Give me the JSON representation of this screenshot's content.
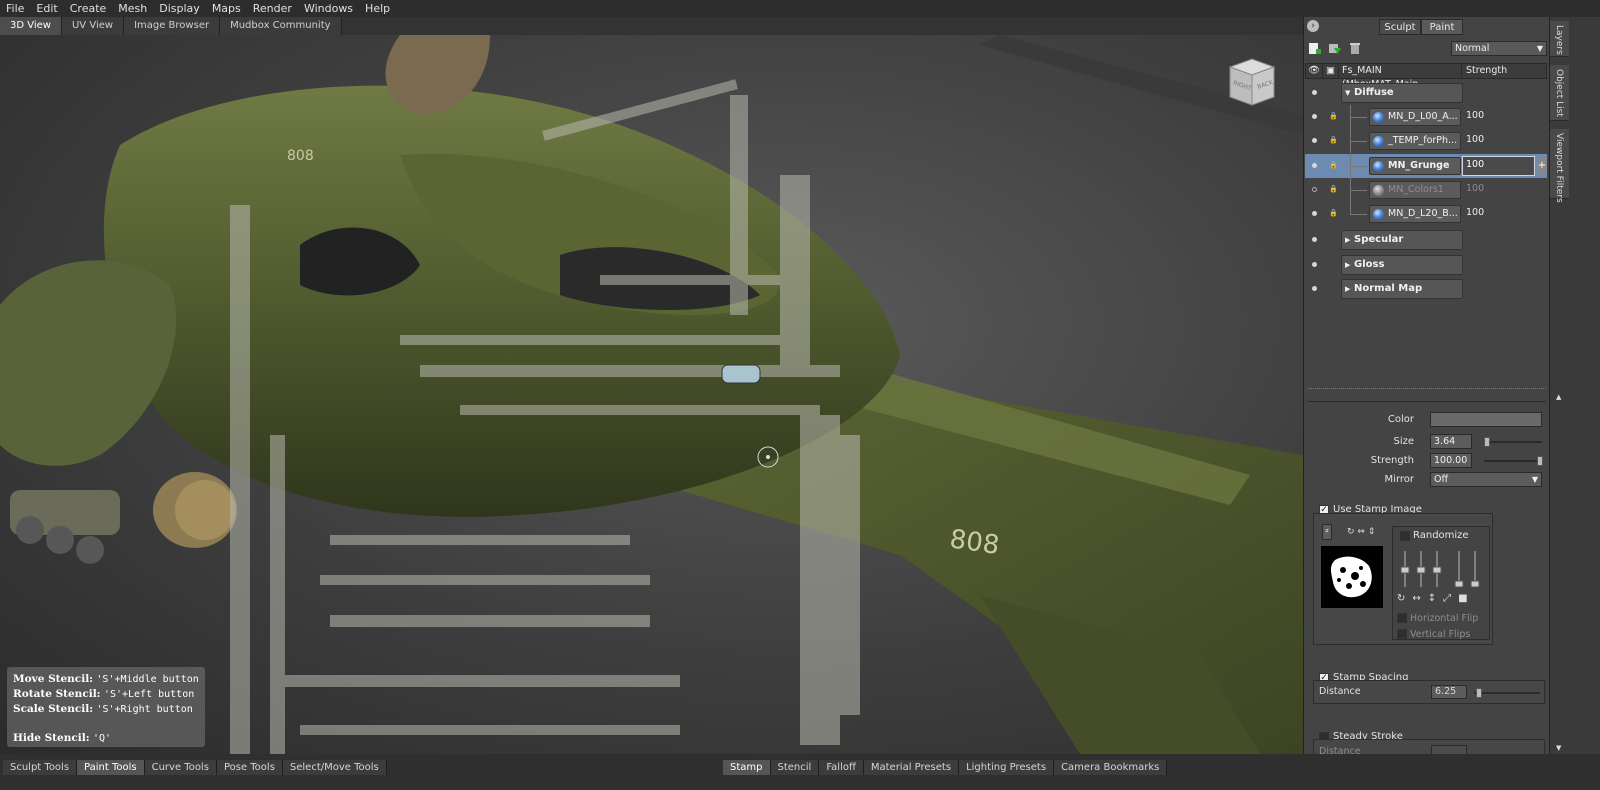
{
  "menu": [
    "File",
    "Edit",
    "Create",
    "Mesh",
    "Display",
    "Maps",
    "Render",
    "Windows",
    "Help"
  ],
  "view_tabs": [
    "3D View",
    "UV View",
    "Image Browser",
    "Mudbox Community"
  ],
  "viewcube": {
    "face_right": "RIGHT",
    "face_back": "BACK"
  },
  "hint": {
    "move_label": "Move Stencil:",
    "move_keys": "'S'+Middle button",
    "rotate_label": "Rotate Stencil:",
    "rotate_keys": "'S'+Left button",
    "scale_label": "Scale Stencil:",
    "scale_keys": "'S'+Right button",
    "hide_label": "Hide Stencil:",
    "hide_keys": "'Q'"
  },
  "panel": {
    "mode_sculpt": "Sculpt",
    "mode_paint": "Paint",
    "blend_mode": "Normal",
    "header_name": "Fs_MAIN (MboxMAT_Main",
    "header_strength": "Strength",
    "diffuse": "Diffuse",
    "layers": [
      {
        "name": "MN_D_L00_A...",
        "value": "100"
      },
      {
        "name": "_TEMP_forPh...",
        "value": "100"
      },
      {
        "name": "MN_Grunge",
        "value": "100"
      },
      {
        "name": "MN_Colors1",
        "value": "100"
      },
      {
        "name": "MN_D_L20_B...",
        "value": "100"
      }
    ],
    "groups": [
      "Specular",
      "Gloss",
      "Normal Map"
    ]
  },
  "side_tabs": [
    "Layers",
    "Object List",
    "Viewport Filters"
  ],
  "props": {
    "color_label": "Color",
    "size_label": "Size",
    "size_value": "3.64",
    "strength_label": "Strength",
    "strength_value": "100.00",
    "mirror_label": "Mirror",
    "mirror_value": "Off"
  },
  "stamp": {
    "use_stamp_label": "Use Stamp Image",
    "randomize": "Randomize",
    "horizontal_flip": "Horizontal Flip",
    "vertical_flips": "Vertical Flips",
    "spacing_label": "Stamp Spacing",
    "distance_label": "Distance",
    "distance_value": "6.25",
    "steady_label": "Steady Stroke",
    "steady_distance_label": "Distance"
  },
  "tool_tabs": [
    "Sculpt Tools",
    "Paint Tools",
    "Curve Tools",
    "Pose Tools",
    "Select/Move Tools"
  ],
  "tray_tabs": [
    "Stamp",
    "Stencil",
    "Falloff",
    "Material Presets",
    "Lighting Presets",
    "Camera Bookmarks"
  ],
  "model_decal": "808"
}
